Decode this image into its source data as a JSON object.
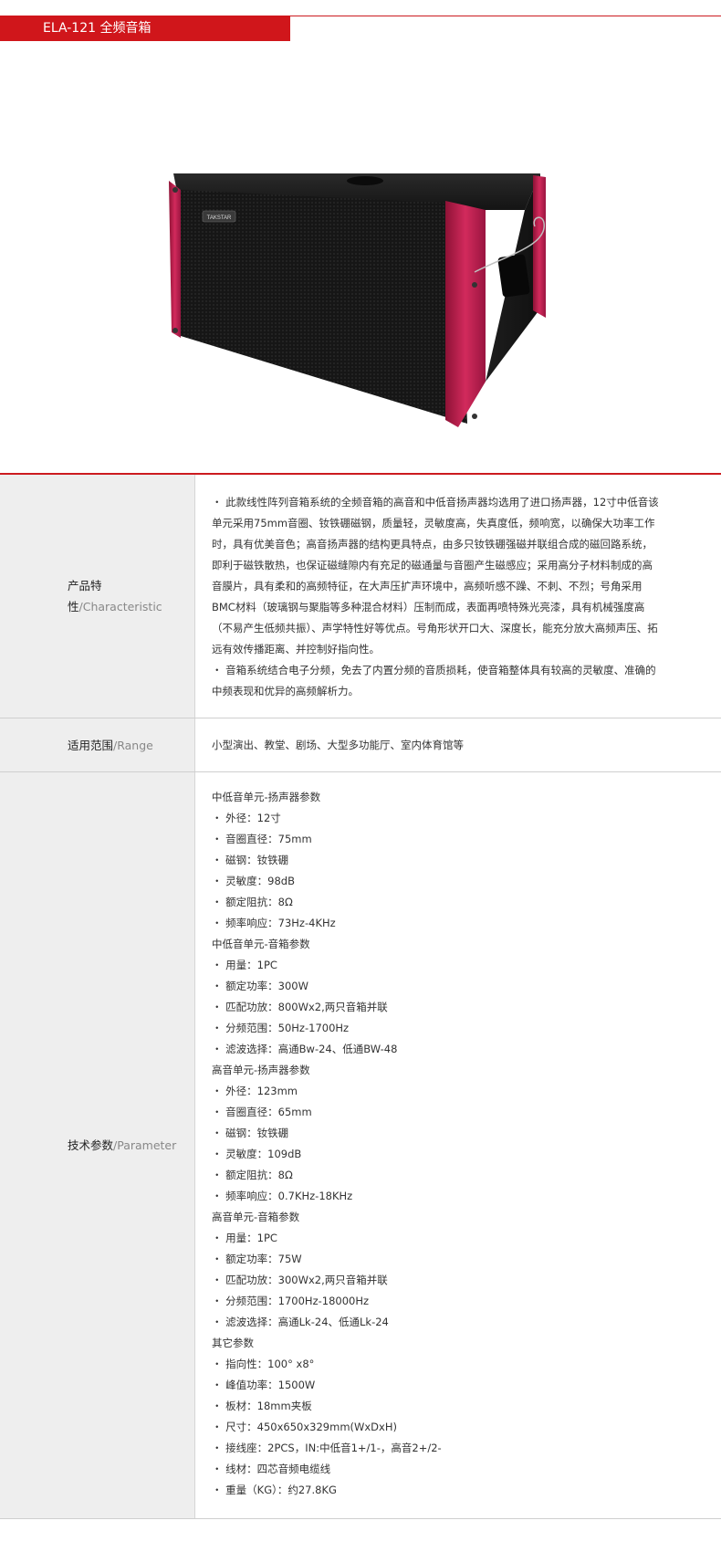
{
  "header": {
    "title": "ELA-121 全频音箱"
  },
  "product": {
    "brand": "TAKSTAR",
    "image_alt": "ELA-121 line array full-range speaker cabinet",
    "colors": {
      "accent": "#d0161b",
      "cabinet": "#1b1b1b",
      "side_panel": "#c2204f"
    }
  },
  "rows": [
    {
      "label": "产品特性",
      "label_en": "/Characteristic",
      "paragraphs": [
        "・ 此款线性阵列音箱系统的全频音箱的高音和中低音扬声器均选用了进口扬声器，12寸中低音该单元采用75mm音圈、钕铁硼磁钢，质量轻，灵敏度高，失真度低，频响宽，以确保大功率工作时，具有优美音色；高音扬声器的结构更具特点，由多只钕铁硼强磁并联组合成的磁回路系统，即利于磁铁散热，也保证磁缝隙内有充足的磁通量与音圈产生磁感应；采用高分子材料制成的高音膜片，具有柔和的高频特征，在大声压扩声环境中，高频听感不躁、不刺、不烈；号角采用BMC材料（玻璃钢与聚脂等多种混合材料）压制而成，表面再喷特殊光亮漆，具有机械强度高（不易产生低频共振）、声学特性好等优点。号角形状开口大、深度长，能充分放大高频声压、拓远有效传播距离、并控制好指向性。",
        "・ 音箱系统结合电子分频，免去了内置分频的音质损耗，使音箱整体具有较高的灵敏度、准确的中频表现和优异的高频解析力。"
      ]
    },
    {
      "label": "适用范围",
      "label_en": "/Range",
      "text": "小型演出、教堂、剧场、大型多功能厅、室内体育馆等"
    },
    {
      "label": "技术参数",
      "label_en": "/Parameter",
      "lines": [
        "中低音单元-扬声器参数",
        "・ 外径：12寸",
        "・ 音圈直径：75mm",
        "・ 磁钢：钕铁硼",
        "・ 灵敏度：98dB",
        "・ 额定阻抗：8Ω",
        "・ 频率响应：73Hz-4KHz",
        "中低音单元-音箱参数",
        "・ 用量：1PC",
        "・ 额定功率：300W",
        "・ 匹配功放：800Wx2,两只音箱并联",
        "・ 分频范围：50Hz-1700Hz",
        "・ 滤波选择：高通Bw-24、低通BW-48",
        "高音单元-扬声器参数",
        "・ 外径：123mm",
        "・ 音圈直径：65mm",
        "・ 磁钢：钕铁硼",
        "・ 灵敏度：109dB",
        "・ 额定阻抗：8Ω",
        "・ 频率响应：0.7KHz-18KHz",
        "高音单元-音箱参数",
        "・ 用量：1PC",
        "・ 额定功率：75W",
        "・ 匹配功放：300Wx2,两只音箱并联",
        "・ 分频范围：1700Hz-18000Hz",
        "・ 滤波选择：高通Lk-24、低通Lk-24",
        "其它参数",
        "・ 指向性：100° x8°",
        "・ 峰值功率：1500W",
        "・ 板材：18mm夹板",
        "・ 尺寸：450x650x329mm(WxDxH)",
        "・ 接线座：2PCS，IN:中低音1+/1-，高音2+/2-",
        "・ 线材：四芯音频电缆线",
        "・ 重量（KG）：约27.8KG"
      ]
    }
  ]
}
